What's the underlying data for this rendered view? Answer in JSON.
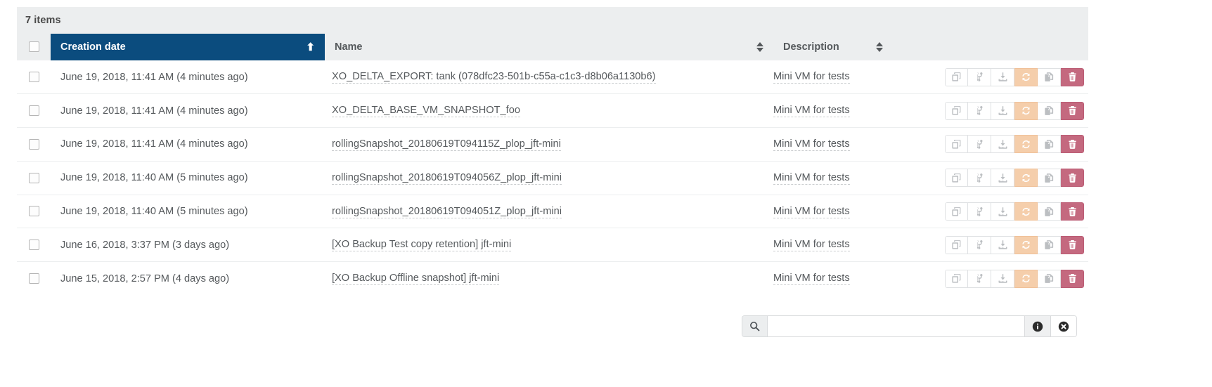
{
  "header": {
    "items_count": "7 items"
  },
  "columns": [
    {
      "label": "Creation date",
      "sort": "asc"
    },
    {
      "label": "Name",
      "sort": "none"
    },
    {
      "label": "Description",
      "sort": "none"
    }
  ],
  "rows": [
    {
      "date": "June 19, 2018, 11:41 AM (4 minutes ago)",
      "name": "XO_DELTA_EXPORT: tank (078dfc23-501b-c55a-c1c3-d8b06a1130b6)",
      "description": "Mini VM for tests"
    },
    {
      "date": "June 19, 2018, 11:41 AM (4 minutes ago)",
      "name": "XO_DELTA_BASE_VM_SNAPSHOT_foo",
      "description": "Mini VM for tests"
    },
    {
      "date": "June 19, 2018, 11:41 AM (4 minutes ago)",
      "name": "rollingSnapshot_20180619T094115Z_plop_jft-mini",
      "description": "Mini VM for tests"
    },
    {
      "date": "June 19, 2018, 11:40 AM (5 minutes ago)",
      "name": "rollingSnapshot_20180619T094056Z_plop_jft-mini",
      "description": "Mini VM for tests"
    },
    {
      "date": "June 19, 2018, 11:40 AM (5 minutes ago)",
      "name": "rollingSnapshot_20180619T094051Z_plop_jft-mini",
      "description": "Mini VM for tests"
    },
    {
      "date": "June 16, 2018, 3:37 PM (3 days ago)",
      "name": "[XO Backup Test copy retention] jft-mini",
      "description": "Mini VM for tests"
    },
    {
      "date": "June 15, 2018, 2:57 PM (4 days ago)",
      "name": "[XO Backup Offline snapshot] jft-mini",
      "description": "Mini VM for tests"
    }
  ],
  "row_actions": [
    {
      "icon": "copy-icon",
      "style": "plain"
    },
    {
      "icon": "code-fork-icon",
      "style": "plain"
    },
    {
      "icon": "download-icon",
      "style": "plain"
    },
    {
      "icon": "refresh-icon",
      "style": "warn"
    },
    {
      "icon": "copy-files-icon",
      "style": "plain"
    },
    {
      "icon": "trash-icon",
      "style": "danger"
    }
  ],
  "search": {
    "prefix_icon": "search-icon",
    "value": "",
    "placeholder": "",
    "info_icon": "info-circle-icon",
    "clear_icon": "times-circle-icon"
  },
  "colors": {
    "sorted_header": "#0b4c7e",
    "header_bg": "#eceeef",
    "text": "#55595c",
    "warn": "#f5ceab",
    "danger": "#c4697f"
  }
}
